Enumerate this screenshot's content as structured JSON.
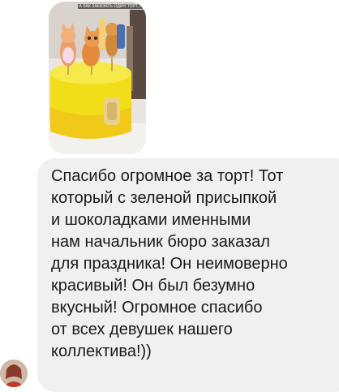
{
  "chat": {
    "image_message": {
      "caption": "А КАК ЗАКАЗАТЬ ОДИН ТОРТ..."
    },
    "text_message": {
      "text": "Спасибо огромное за торт! Тот\nкоторый с зеленой присыпкой\nи шоколадками именными\nнам начальник бюро заказал\nдля праздника! Он неимоверно\nкрасивый! Он был безумно\nвкусный! Огромное спасибо\nот всех девушек нашего\nколлектива!))"
    }
  }
}
